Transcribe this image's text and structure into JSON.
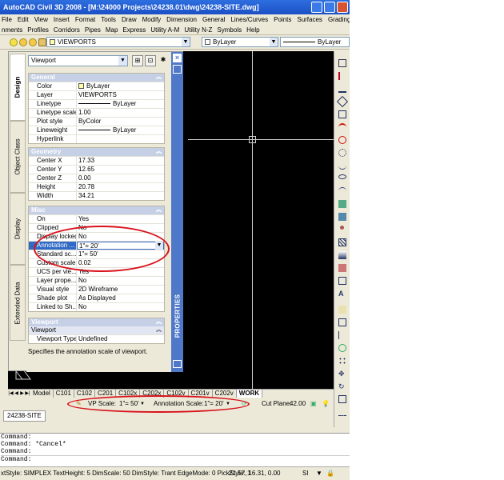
{
  "window": {
    "title": "AutoCAD Civil 3D 2008 - [M:\\24000 Projects\\24238.01\\dwg\\24238-SITE.dwg]"
  },
  "menubar": {
    "items": [
      "File",
      "Edit",
      "View",
      "Insert",
      "Format",
      "Tools",
      "Draw",
      "Modify",
      "Dimension",
      "General",
      "Lines/Curves",
      "Points",
      "Surfaces",
      "Grading"
    ],
    "items2": [
      "nments",
      "Profiles",
      "Corridors",
      "Pipes",
      "Map",
      "Express",
      "Utility A-M",
      "Utility N-Z",
      "Symbols",
      "Help"
    ]
  },
  "toolbar": {
    "layer_value": "VIEWPORTS",
    "color_value": "ByLayer",
    "linetype_value": "ByLayer"
  },
  "properties": {
    "palette_title": "PROPERTIES",
    "object_type": "Viewport",
    "side_tabs": [
      "Design",
      "Object Class",
      "Display",
      "Extended Data"
    ],
    "sections": {
      "general": {
        "title": "General",
        "rows": [
          {
            "k": "Color",
            "v": "ByLayer"
          },
          {
            "k": "Layer",
            "v": "VIEWPORTS"
          },
          {
            "k": "Linetype",
            "v": "ByLayer"
          },
          {
            "k": "Linetype scale",
            "v": "1.00"
          },
          {
            "k": "Plot style",
            "v": "ByColor"
          },
          {
            "k": "Lineweight",
            "v": "ByLayer"
          },
          {
            "k": "Hyperlink",
            "v": ""
          }
        ]
      },
      "geometry": {
        "title": "Geometry",
        "rows": [
          {
            "k": "Center X",
            "v": "17.33"
          },
          {
            "k": "Center Y",
            "v": "12.65"
          },
          {
            "k": "Center Z",
            "v": "0.00"
          },
          {
            "k": "Height",
            "v": "20.78"
          },
          {
            "k": "Width",
            "v": "34.21"
          }
        ]
      },
      "misc": {
        "title": "Misc",
        "rows": [
          {
            "k": "On",
            "v": "Yes"
          },
          {
            "k": "Clipped",
            "v": "No"
          },
          {
            "k": "Display locked",
            "v": "No"
          },
          {
            "k": "Annotation ...",
            "v": "1\"= 20'"
          },
          {
            "k": "Standard sc...",
            "v": "1\"= 50'"
          },
          {
            "k": "Custom scale",
            "v": "0.02"
          },
          {
            "k": "UCS per vie...",
            "v": "Yes"
          },
          {
            "k": "Layer prope...",
            "v": "No"
          },
          {
            "k": "Visual style",
            "v": "2D Wireframe"
          },
          {
            "k": "Shade plot",
            "v": "As Displayed"
          },
          {
            "k": "Linked to Sh...",
            "v": "No"
          }
        ]
      },
      "viewport": {
        "title": "Viewport",
        "sub": "Viewport",
        "rows": [
          {
            "k": "Viewport Type",
            "v": "Undefined"
          }
        ]
      }
    },
    "description": "Specifies the annotation scale of viewport."
  },
  "layout_tabs": [
    "Model",
    "C101",
    "C102",
    "C201",
    "C102x",
    "C202x",
    "C102v",
    "C201v",
    "C202v",
    "WORK"
  ],
  "status_row": {
    "vp_scale_label": "VP Scale:",
    "vp_scale_value": "1\"= 50'",
    "annotation_scale_label": "Annotation Scale:",
    "annotation_scale_value": "1\"= 20'",
    "cut_plane_label": "Cut Plane:",
    "cut_plane_value": "42.00"
  },
  "document_tab": "24238-SITE",
  "command_lines": [
    "Command:",
    "Command: *Cancel*",
    "Command:",
    "Command:"
  ],
  "status_bar": {
    "text": "xtStyle: SIMPLEX TextHeight: 5 DimScale: 50 DimStyle: Trant EdgeMode: 0 PickStyle: 1",
    "coords": "21.57, 16.31, 0.00"
  },
  "colors": {
    "title_blue": "#2e6fe0",
    "palette_blue": "#4f78c8",
    "highlight_red": "#d8121b",
    "canvas_black": "#000000"
  }
}
